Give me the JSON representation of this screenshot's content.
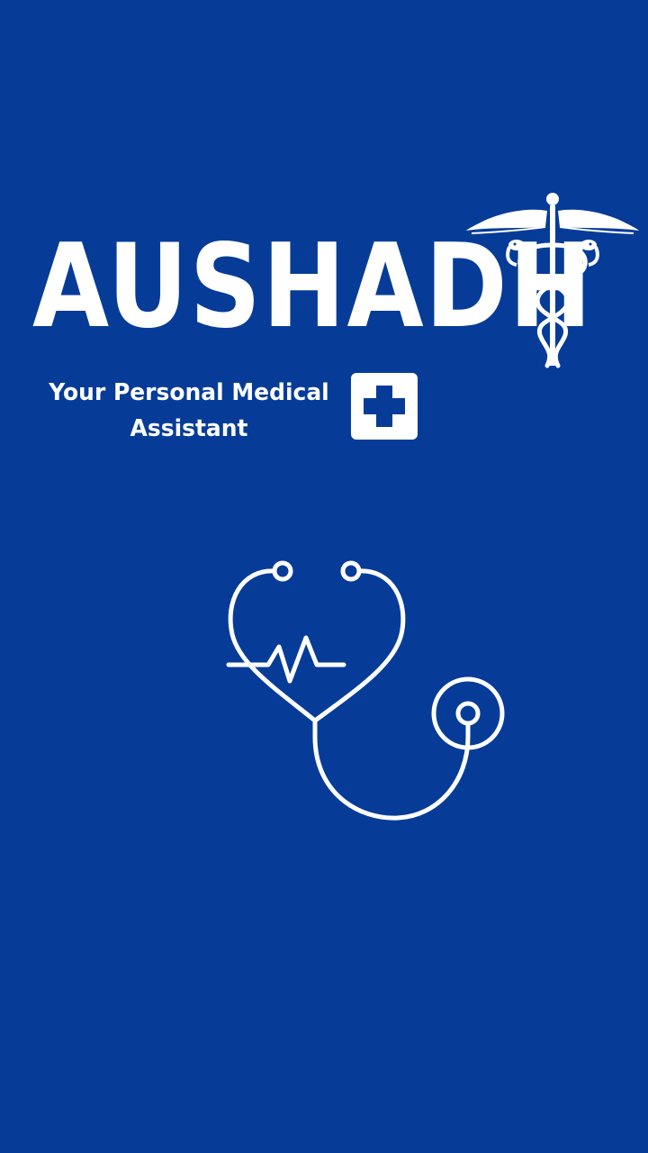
{
  "splash": {
    "app_name": "AUSHADH",
    "tagline_line1": "Your Personal Medical",
    "tagline_line2": "Assistant"
  },
  "icons": {
    "caduceus": "caduceus-icon",
    "medical_cross": "medical-cross-icon",
    "stethoscope": "stethoscope-icon"
  },
  "colors": {
    "background": "#063c98",
    "foreground": "#ffffff"
  }
}
